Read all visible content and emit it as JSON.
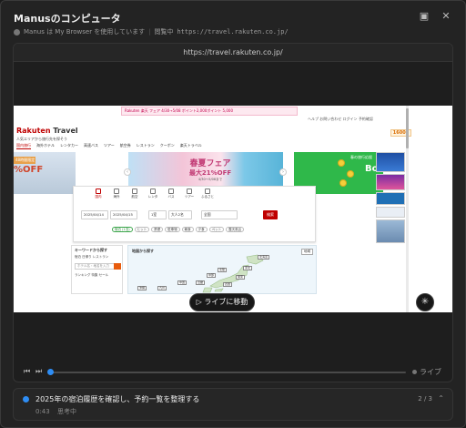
{
  "header": {
    "title": "Manusのコンピュータ",
    "subtitle": "Manus は My Browser を使用しています",
    "status": "閲覧中",
    "url": "https://travel.rakuten.co.jp/"
  },
  "viewer": {
    "address": "https://travel.rakuten.co.jp/"
  },
  "site": {
    "logo_prefix": "Rakuten",
    "logo_suffix": " Travel",
    "promo": "Rakuten 楽天 フェア 4/30→5/08  ポイント2,000ポイント  5,000",
    "tagline": "人気エリアから旅行先を探そう",
    "header_links": "ヘルプ  お問い合わせ  ログイン  予約確認",
    "points": "16000",
    "nav": [
      "国内旅行",
      "海外ホテル",
      "レンタカー",
      "高速バス",
      "ツアー",
      "航空券",
      "レストラン",
      "クーポン",
      "楽天トラベル"
    ],
    "banner_left_ribbon": "48時間限定",
    "banner_left_off": "%OFF",
    "banner_main_t1": "春夏フェア",
    "banner_main_t2": "最大21%OFF",
    "banner_main_t3": "4/30〜5/08まで",
    "banner_right_note": "春の旅行応援",
    "banner_right_big": "Bo",
    "tabs": [
      "国内",
      "海外",
      "航空",
      "レンタ",
      "バス",
      "ツアー",
      "ふるさと"
    ],
    "fields": {
      "checkin": "2025/04/14",
      "checkout": "2025/04/15",
      "rooms": "1室",
      "guests": "大人2名",
      "area": "全国",
      "search": "検索"
    },
    "chips": [
      "宿泊 (1泊)",
      "ヒット",
      "禁煙",
      "駐車場",
      "朝食",
      "夕食",
      "ペット",
      "露天風呂"
    ],
    "keyword": {
      "title": "キーワードから探す",
      "options": "宿泊  日帰り  レストラン",
      "placeholder": "ホテル名・地名を入力",
      "sub": "ランキング  特集  セール"
    },
    "map": {
      "title": "地図から探す",
      "full": "地域",
      "prefs": [
        "北海道",
        "東北",
        "関東",
        "北陸",
        "中部",
        "近畿",
        "中国",
        "四国",
        "九州",
        "沖縄"
      ]
    }
  },
  "controls": {
    "live_button": "ライブに移動",
    "live_label": "ライブ"
  },
  "task": {
    "title": "2025年の宿泊履歴を確認し、予約一覧を整理する",
    "time": "0:43",
    "state": "思考中",
    "step": "2 / 3"
  },
  "playback": {
    "progress": 0.0
  },
  "colors": {
    "accent": "#2e8df4",
    "rakuten_red": "#bf0000",
    "panel_bg": "#232323"
  }
}
